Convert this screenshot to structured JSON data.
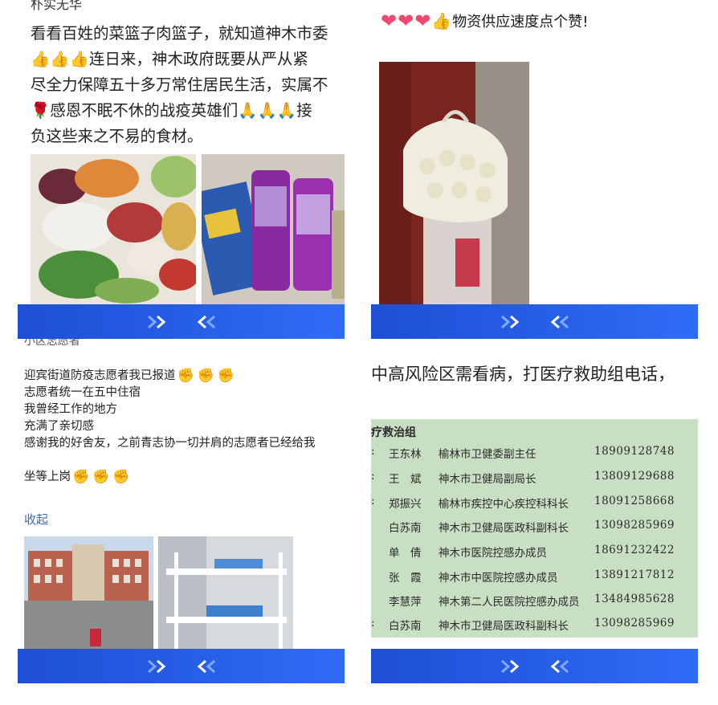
{
  "nav": {
    "next_symbol": "»",
    "prev_symbol": "«"
  },
  "panel1": {
    "cut_top_text": "朴实无华",
    "lines": [
      "看看百姓的菜篮子肉篮子，就知道神木市委",
      "👍👍👍连日来，神木政府既要从严从紧",
      "尽全力保障五十多万常住居民生活，实属不",
      "🌹感恩不眠不休的战疫英雄们🙏🙏🙏接",
      "负这些来之不易的食材。"
    ],
    "photo1_alt": "蔬菜肉类食材",
    "photo2_alt": "薯片零食"
  },
  "panel2": {
    "text": "物资供应速度点个赞!",
    "hearts": [
      "❤",
      "❤",
      "❤"
    ],
    "thumb": "👍",
    "photo_alt": "电梯内一袋鸡蛋"
  },
  "panel3": {
    "cut_top_text": "小区志愿者",
    "line1": "迎宾街道防疫志愿者我已报道",
    "line2": "志愿者统一在五中住宿",
    "line3": "我曾经工作的地方",
    "line4": "充满了亲切感",
    "line5": "感谢我的好舍友，之前青志协一切并肩的志愿者已经给我",
    "line6": "坐等上岗",
    "fist": "✊",
    "collapse_label": "收起",
    "photo1_alt": "学校大楼",
    "photo2_alt": "宿舍上下铺"
  },
  "panel4": {
    "heading": "中高风险区需看病，打医疗救助组电话，",
    "doc_title": "疗救治组",
    "rows": [
      {
        "prefix": ":",
        "name": "王东林",
        "title": "榆林市卫健委副主任",
        "phone": "18909128748"
      },
      {
        "prefix": ":",
        "name": "王　斌",
        "title": "神木市卫健局副局长",
        "phone": "13809129688"
      },
      {
        "prefix": ":",
        "name": "郑振兴",
        "title": "榆林市疾控中心疾控科科长",
        "phone": "18091258668"
      },
      {
        "prefix": "",
        "name": "白苏南",
        "title": "神木市卫健局医政科副科长",
        "phone": "13098285969"
      },
      {
        "prefix": "",
        "name": "单　倩",
        "title": "神木市医院控感办成员",
        "phone": "18691232422"
      },
      {
        "prefix": "",
        "name": "张　霞",
        "title": "神木市中医院控感办成员",
        "phone": "13891217812"
      },
      {
        "prefix": "",
        "name": "李慧萍",
        "title": "神木第二人民医院控感办成员",
        "phone": "13484985628"
      },
      {
        "prefix": ":",
        "name": "白苏南",
        "title": "神木市卫健局医政科副科长",
        "phone": "13098285969"
      }
    ]
  },
  "colors": {
    "nav_start": "#1d4fd6",
    "nav_end": "#2f6cf5",
    "link": "#3b6bb5",
    "doc_bg": "#c9dfc4"
  }
}
